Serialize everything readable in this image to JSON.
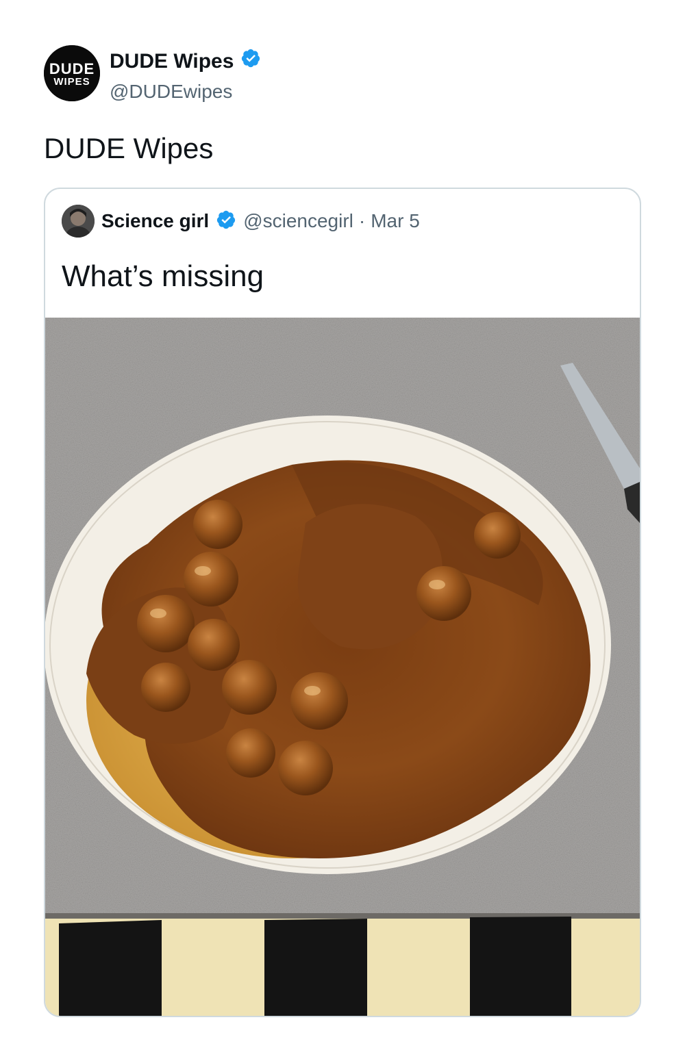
{
  "tweet": {
    "author": {
      "name": "DUDE Wipes",
      "handle": "@DUDEwipes",
      "avatar_text_top": "DUDE",
      "avatar_text_bottom": "WIPES",
      "verified": true
    },
    "text": "DUDE Wipes"
  },
  "quoted_tweet": {
    "author": {
      "name": "Science girl",
      "handle": "@sciencegirl",
      "verified": true
    },
    "separator": "·",
    "date": "Mar 5",
    "text": "What’s missing",
    "media": {
      "description_icon": "food-plate-photo"
    }
  },
  "colors": {
    "verified_blue": "#1d9bf0",
    "secondary_text": "#536471",
    "border": "#cfd9de"
  }
}
